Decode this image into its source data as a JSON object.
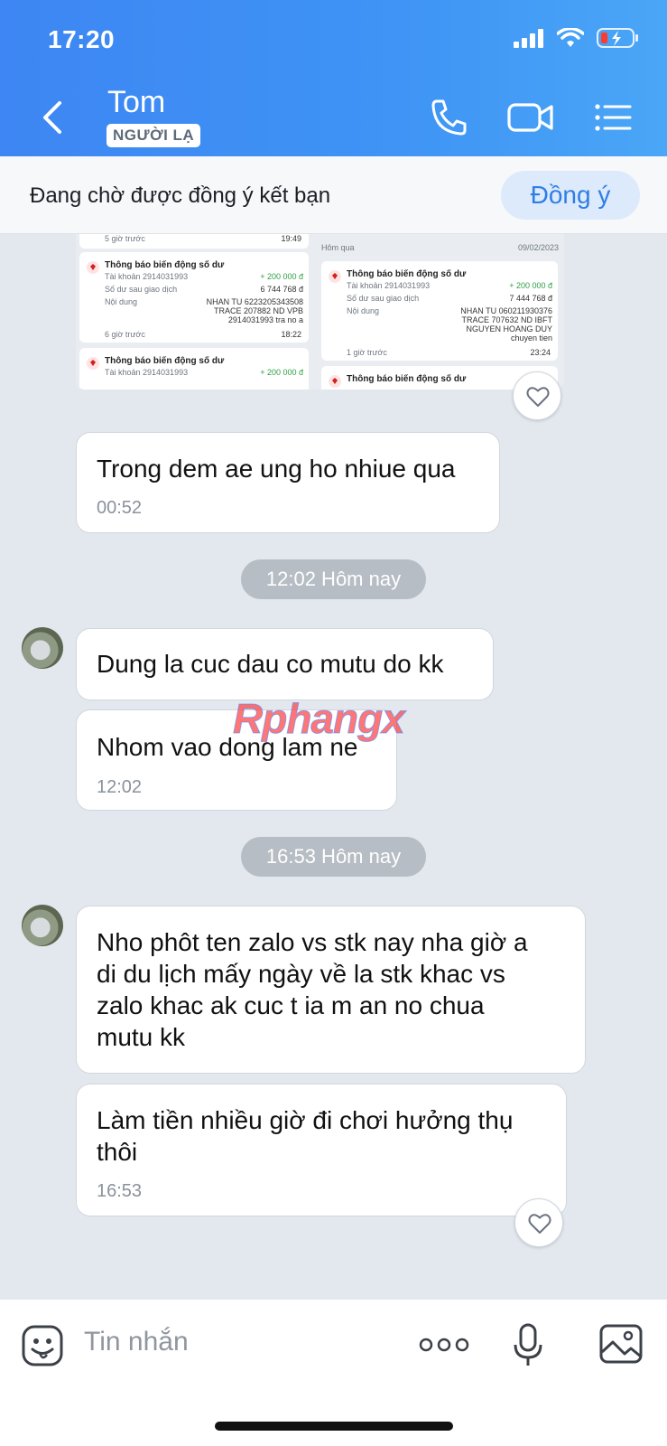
{
  "status_bar": {
    "time": "17:20"
  },
  "header": {
    "contact_name": "Tom",
    "badge": "NGƯỜI LẠ"
  },
  "pending": {
    "text": "Đang chờ được đồng ý kết bạn",
    "accept_label": "Đồng ý"
  },
  "transaction_screenshot": {
    "left": {
      "top_time_ago": "5 giờ trước",
      "top_time": "19:49",
      "card1": {
        "title": "Thông báo biến động số dư",
        "account_label": "Tài khoản 2914031993",
        "amount": "+ 200 000 đ",
        "balance_label": "Số dư sau giao dịch",
        "balance": "6 744 768 đ",
        "content_label": "Nội dung",
        "content": [
          "NHAN TU 6223205343508",
          "TRACE 207882 ND VPB",
          "2914031993 tra no a"
        ],
        "time_ago": "6 giờ trước",
        "time": "18:22"
      },
      "card2": {
        "title": "Thông báo biến động số dư",
        "account_label": "Tài khoản 2914031993",
        "amount": "+ 200 000 đ"
      }
    },
    "right": {
      "date_label": "Hôm qua",
      "date": "09/02/2023",
      "card1": {
        "title": "Thông báo biến động số dư",
        "account_label": "Tài khoản 2914031993",
        "amount": "+ 200 000 đ",
        "balance_label": "Số dư sau giao dịch",
        "balance": "7 444 768 đ",
        "content_label": "Nội dung",
        "content": [
          "NHAN TU 060211930376",
          "TRACE 707632 ND IBFT",
          "NGUYEN HOANG DUY",
          "chuyen tien"
        ],
        "time_ago": "1 giờ trước",
        "time": "23:24"
      },
      "card2": {
        "title": "Thông báo biến động số dư"
      }
    }
  },
  "messages": [
    {
      "text": "Trong dem ae ung ho nhiue qua",
      "time": "00:52"
    },
    {
      "text": "Dung la cuc dau co mutu do kk"
    },
    {
      "text": "Nhom vao dong lam ne",
      "time": "12:02"
    },
    {
      "text_lines": [
        "Nho phôt ten zalo vs stk nay nha giờ a",
        "di du lịch mấy ngày về la stk khac vs",
        "zalo khac ak cuc t ia m an no chua",
        "mutu kk"
      ]
    },
    {
      "text_lines": [
        "Làm tiền nhiều giờ đi chơi hưởng thụ",
        "thôi"
      ],
      "time": "16:53"
    }
  ],
  "separators": [
    "12:02 Hôm nay",
    "16:53 Hôm nay"
  ],
  "watermark": "Rphangx",
  "composer": {
    "placeholder": "Tin nhắn"
  }
}
